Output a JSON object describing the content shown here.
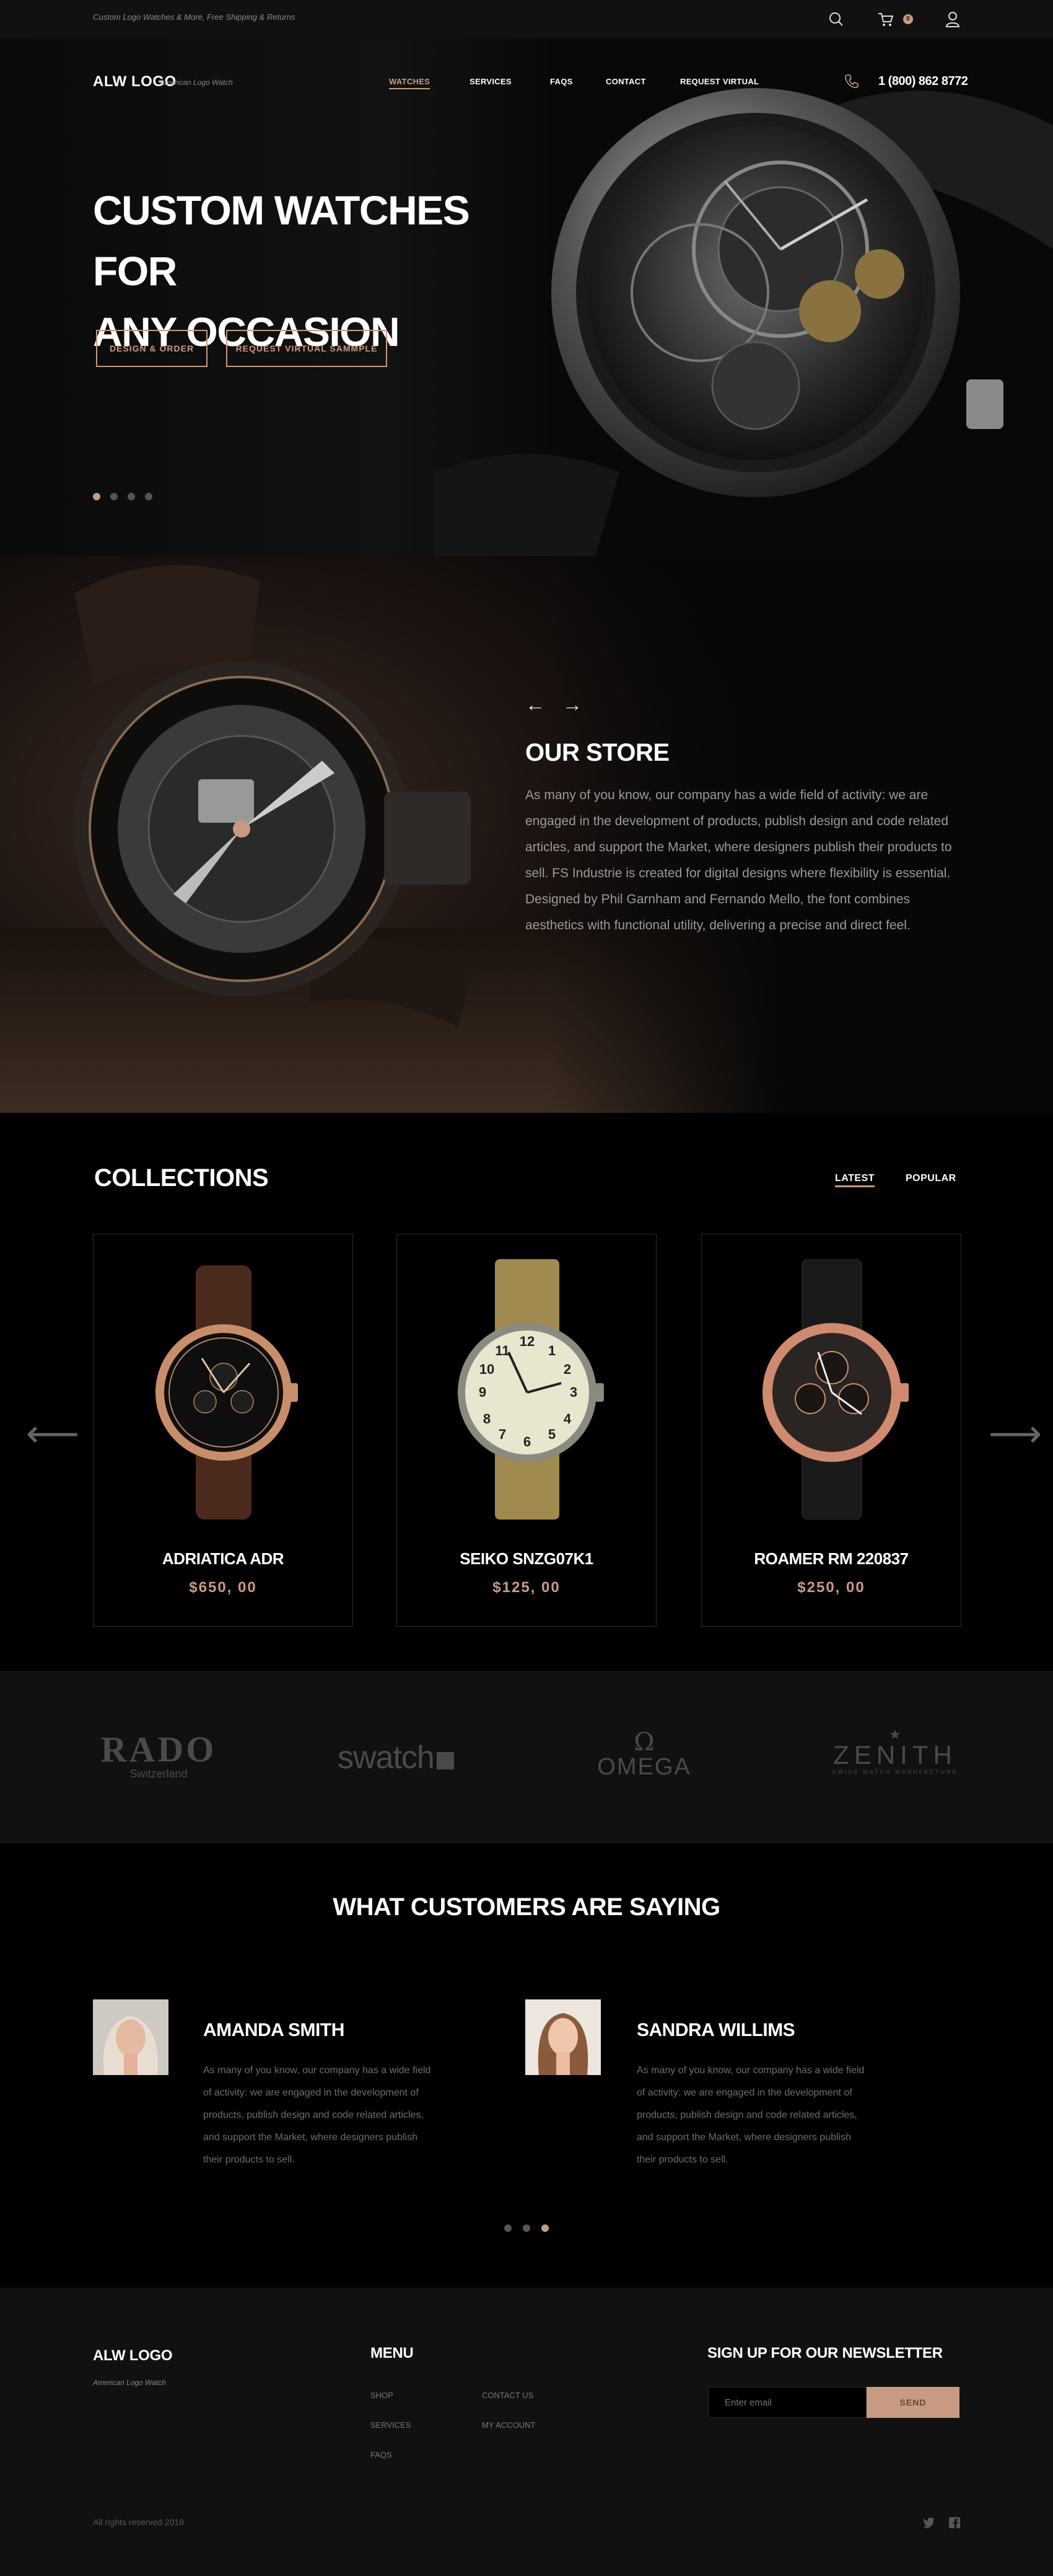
{
  "topbar": {
    "promo": "Custom Logo Watches & More, Free Shipping & Returns",
    "cart_count": "0",
    "icons": [
      "search-icon",
      "cart-icon",
      "user-icon"
    ]
  },
  "header": {
    "logo": "ALW LOGO",
    "logo_sub": "American Logo Watch",
    "nav": [
      "WATCHES",
      "SERVICES",
      "FAQS",
      "CONTACT",
      "REQUEST VIRTUAL"
    ],
    "active_nav": "WATCHES",
    "phone": "1 (800) 862  8772"
  },
  "hero": {
    "title_line1": "CUSTOM WATCHES FOR",
    "title_line2": "ANY OCCASION",
    "btn_design": "DESIGN & ORDER",
    "btn_request": "REQUEST VIRTUAL SAMMPLE",
    "slides": 4,
    "active_slide": 1
  },
  "store": {
    "title": "OUR STORE",
    "text": "As many of you know, our company has a wide field of activity: we are engaged in the development of products, publish design and code related articles, and support the Market, where designers publish their products to sell. FS Industrie is created for digital designs where flexibility is essential. Designed by Phil Garnham and Fernando Mello, the font combines aesthetics with functional utility, delivering a precise and direct feel.",
    "prev": "←",
    "next": "→"
  },
  "collections": {
    "title": "COLLECTIONS",
    "tabs": [
      "LATEST",
      "POPULAR"
    ],
    "active_tab": "LATEST",
    "items": [
      {
        "name": "ADRIATICA ADR",
        "price": "$650, 00"
      },
      {
        "name": "SEIKO SNZG07K1",
        "price": "$125, 00"
      },
      {
        "name": "ROAMER RM 220837",
        "price": "$250, 00"
      }
    ]
  },
  "brands": {
    "rado": "RADO",
    "rado_sub": "Switzerland",
    "swatch": "swatch",
    "omega": "OMEGA",
    "zenith": "ZENITH",
    "zenith_sub": "SWISS WATCH MANUFACTURE"
  },
  "testimonials": {
    "title": "WHAT CUSTOMERS ARE SAYING",
    "items": [
      {
        "name": "AMANDA SMITH",
        "text": "As many of you know, our company has a wide field of activity: we are engaged in the development of products, publish design and code related articles, and support the Market, where designers publish their products to sell."
      },
      {
        "name": "SANDRA  WILLIMS",
        "text": "As many of you know, our company has a wide field of activity: we are engaged in the development of products, publish design and code related articles, and support the Market, where designers publish their products to sell."
      }
    ],
    "active_dot": 3
  },
  "footer": {
    "logo": "ALW LOGO",
    "logo_sub": "American Logo Watch",
    "menu_title": "MENU",
    "menu_col1": [
      "SHOP",
      "SERVICES",
      "FAQS"
    ],
    "menu_col2": [
      "CONTACT US",
      "MY ACCOUNT"
    ],
    "newsletter_title": "SIGN UP FOR OUR NEWSLETTER",
    "email_placeholder": "Enter email",
    "send": "SEND",
    "copyright": "All rights reserved 2018",
    "social": [
      "twitter-icon",
      "facebook-icon"
    ]
  },
  "colors": {
    "accent": "#c89a82",
    "background": "#000000",
    "panel": "#111111"
  }
}
